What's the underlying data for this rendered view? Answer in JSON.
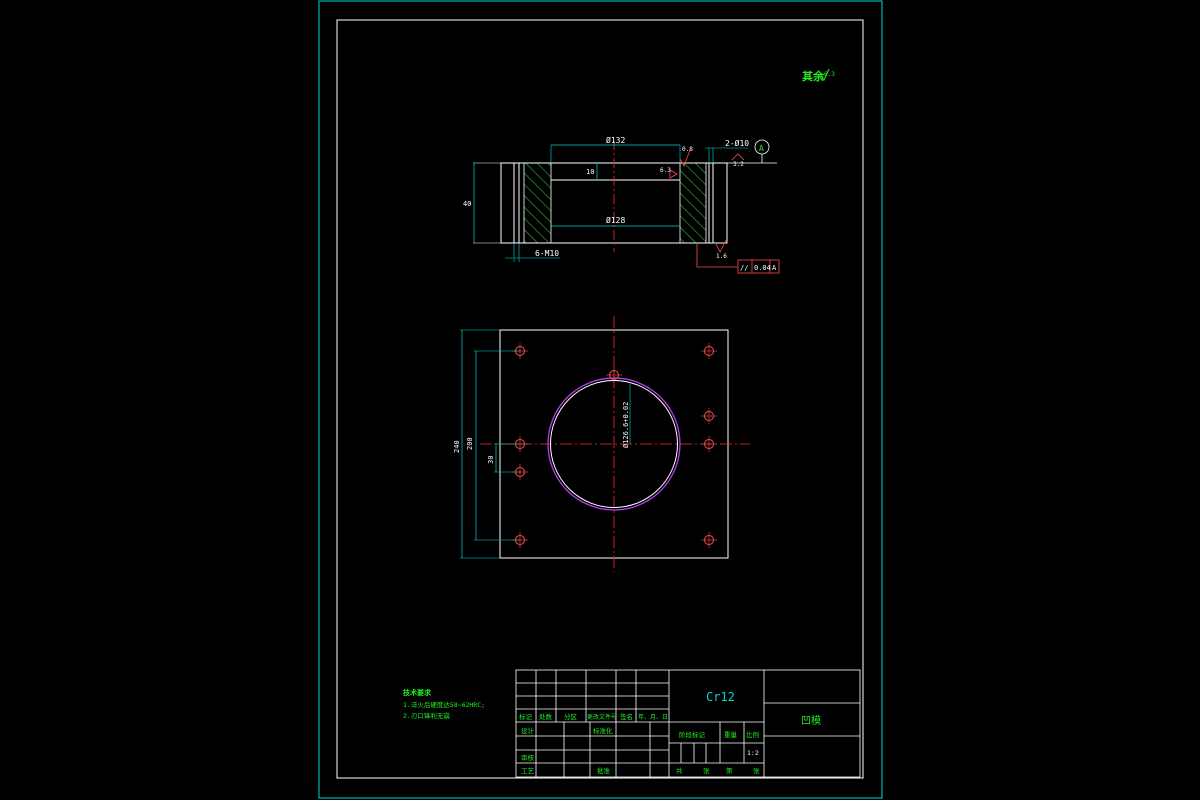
{
  "drawing": {
    "material": "Cr12",
    "part_name": "凹模",
    "scale": "1:2",
    "roughness_note": "其余",
    "roughness_value": "6.3",
    "tech_requirements": {
      "title": "技术要求",
      "line1": "1.淬火后硬度达58~62HRC;",
      "line2": "2.刃口锋利无崩"
    }
  },
  "section_view": {
    "dim_top_dia": "Ø132",
    "dim_bottom_dia": "Ø128",
    "dim_step_height": "10",
    "dim_height": "40",
    "dim_holes": "6-M10",
    "dim_pins": "2-Ø10",
    "roughness_a": "0.8",
    "roughness_b": "6.3",
    "roughness_c": "3.2",
    "roughness_d": "1.6",
    "datum_label": "A",
    "parallel_symbol": "//",
    "parallel_tol": "0.04",
    "parallel_datum": "A"
  },
  "plan_view": {
    "dim_outer": "240",
    "dim_inner": "200",
    "dim_small": "30",
    "dim_cavity": "Ø126.6+0.02"
  },
  "title_block": {
    "row_labels": [
      "标记",
      "处数",
      "分区",
      "更改文件号",
      "签名",
      "年、月、日"
    ],
    "design": "设计",
    "standardize": "标准化",
    "review": "审核",
    "process": "工艺",
    "approve": "批准",
    "stage_mark": "阶段标记",
    "weight": "重量",
    "scale_label": "比例",
    "sheet_total": "共",
    "sheet_unit": "张",
    "sheet_no": "第",
    "sheet_unit2": "张"
  }
}
